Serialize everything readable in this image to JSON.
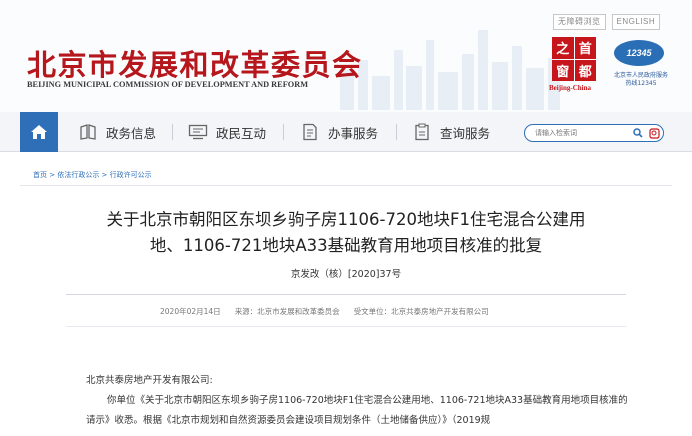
{
  "header": {
    "util_links": [
      "无障碍浏览",
      "ENGLISH"
    ],
    "title_cn": "北京市发展和改革委员会",
    "title_en": "BEIJING MUNICIPAL COMMISSION OF DEVELOPMENT AND REFORM",
    "seal_chars": [
      "之",
      "首",
      "窗",
      "都"
    ],
    "seal_label": "Beijing-China",
    "hotline_number": "12345",
    "hotline_text": "北京市人民政府服务热线12345"
  },
  "nav": {
    "home_icon": "home-icon",
    "items": [
      {
        "label": "政务信息",
        "icon": "book-icon"
      },
      {
        "label": "政民互动",
        "icon": "screen-icon"
      },
      {
        "label": "办事服务",
        "icon": "document-icon"
      },
      {
        "label": "查询服务",
        "icon": "clipboard-icon"
      }
    ],
    "search": {
      "placeholder": "请输入检索词"
    },
    "accent_color": "#2f6fb8"
  },
  "breadcrumb": "首页 > 依法行政公示 > 行政许可公示",
  "article": {
    "title_line1": "关于北京市朝阳区东坝乡驹子房1106-720地块F1住宅混合公建用",
    "title_line2": "地、1106-721地块A33基础教育用地项目核准的批复",
    "doc_number": "京发改（核）[2020]37号",
    "meta": {
      "date": "2020年02月14日",
      "source": "来源：北京市发展和改革委员会",
      "recipient_unit": "受文单位：北京共泰房地产开发有限公司"
    },
    "recipient": "北京共泰房地产开发有限公司:",
    "body": "你单位《关于北京市朝阳区东坝乡驹子房1106-720地块F1住宅混合公建用地、1106-721地块A33基础教育用地项目核准的请示》收悉。根据《北京市规划和自然资源委员会建设项目规划条件（土地储备供应）》（2019规"
  },
  "colors": {
    "brand_red": "#b5171c",
    "nav_blue": "#2f6fb8"
  }
}
